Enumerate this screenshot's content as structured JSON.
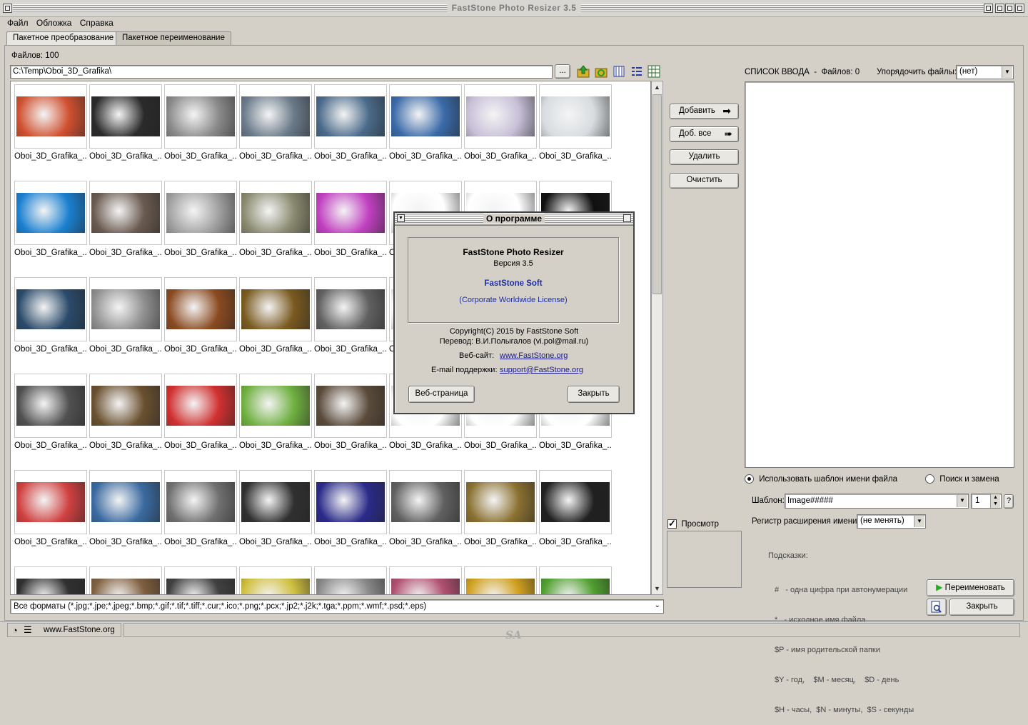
{
  "window": {
    "title": "FastStone Photo Resizer 3.5"
  },
  "menu": [
    "Файл",
    "Обложка",
    "Справка"
  ],
  "tabs": [
    "Пакетное преобразование",
    "Пакетное переименование"
  ],
  "files_count": "Файлов: 100",
  "path": "C:\\Temp\\Oboi_3D_Grafika\\",
  "browse_label": "...",
  "caption": "Oboi_3D_Grafika_...",
  "thumbnails": [
    [
      "#d05030",
      "#2a2a2a",
      "#8a8a8a",
      "#6a7a8a",
      "#4a6a8a",
      "#3a6aa8",
      "#c8c0d8",
      "#d8dce0"
    ],
    [
      "#1a80d0",
      "#6a5a50",
      "#a0a0a0",
      "#8a8a70",
      "#c040c0",
      "#ffffff",
      "#ffffff",
      "#101010"
    ],
    [
      "#2a4a6a",
      "#909090",
      "#8a4a20",
      "#7a5a20",
      "#606060",
      "#ffffff",
      "#ffffff",
      "#ffffff"
    ],
    [
      "#505050",
      "#6a5030",
      "#d03030",
      "#70b040",
      "#5a4a3a",
      "#ffffff",
      "#ffffff",
      "#ffffff"
    ],
    [
      "#d04040",
      "#3a6aa0",
      "#707070",
      "#303030",
      "#2a2a8a",
      "#606060",
      "#8a7030",
      "#202020"
    ],
    [
      "#303030",
      "#806040",
      "#404040",
      "#d0c040",
      "#8a8a8a",
      "#b05070",
      "#d0a020",
      "#50a030"
    ]
  ],
  "format_filter": "Все форматы (*.jpg;*.jpe;*.jpeg;*.bmp;*.gif;*.tif;*.tiff;*.cur;*.ico;*.png;*.pcx;*.jp2;*.j2k;*.tga;*.ppm;*.wmf;*.psd;*.eps)",
  "buttons": {
    "add": "Добавить",
    "add_all": "Доб. все",
    "delete": "Удалить",
    "clear": "Очистить",
    "rename": "Переименовать",
    "close": "Закрыть"
  },
  "preview_label": "Просмотр",
  "input_list": {
    "title": "СПИСОК ВВОДА  -  Файлов: 0",
    "sort_label": "Упорядочить файлы:",
    "sort_value": "(нет)"
  },
  "rename_options": {
    "use_template": "Использовать шаблон имени файла",
    "search_replace": "Поиск и замена",
    "template_label": "Шаблон:",
    "template_value": "Image#####",
    "start_number": "1",
    "help": "?",
    "ext_case_label": "Регистр расширения имени:",
    "ext_case_value": "(не менять)"
  },
  "hints": {
    "title": "Подсказки:",
    "lines": [
      "#   - одна цифра при автонумерации",
      "*   - исходное имя файла",
      "$P - имя родительской папки",
      "$Y - год,    $M - месяц,    $D - день",
      "$H - часы,  $N - минуты,  $S - секунды"
    ]
  },
  "statusbar": {
    "site": "www.FastStone.org",
    "sig": "SA"
  },
  "about_dialog": {
    "title": "О программе",
    "product": "FastStone Photo Resizer",
    "version": "Версия 3.5",
    "company": "FastStone Soft",
    "license": "(Corporate Worldwide License)",
    "copyright": "Copyright(C) 2015 by FastStone Soft",
    "translation": "Перевод: В.И.Полыгалов (vi.pol@mail.ru)",
    "website_label": "Веб-сайт:",
    "website": "www.FastStone.org",
    "email_label": "E-mail поддержки:",
    "email": "support@FastStone.org",
    "webpage_button": "Веб-страница",
    "close_button": "Закрыть"
  },
  "colors": {
    "window_bg": "#d4d0c8",
    "link": "#1a1a8a",
    "company": "#1f2fa0",
    "rename_arrow": "#20b020"
  }
}
